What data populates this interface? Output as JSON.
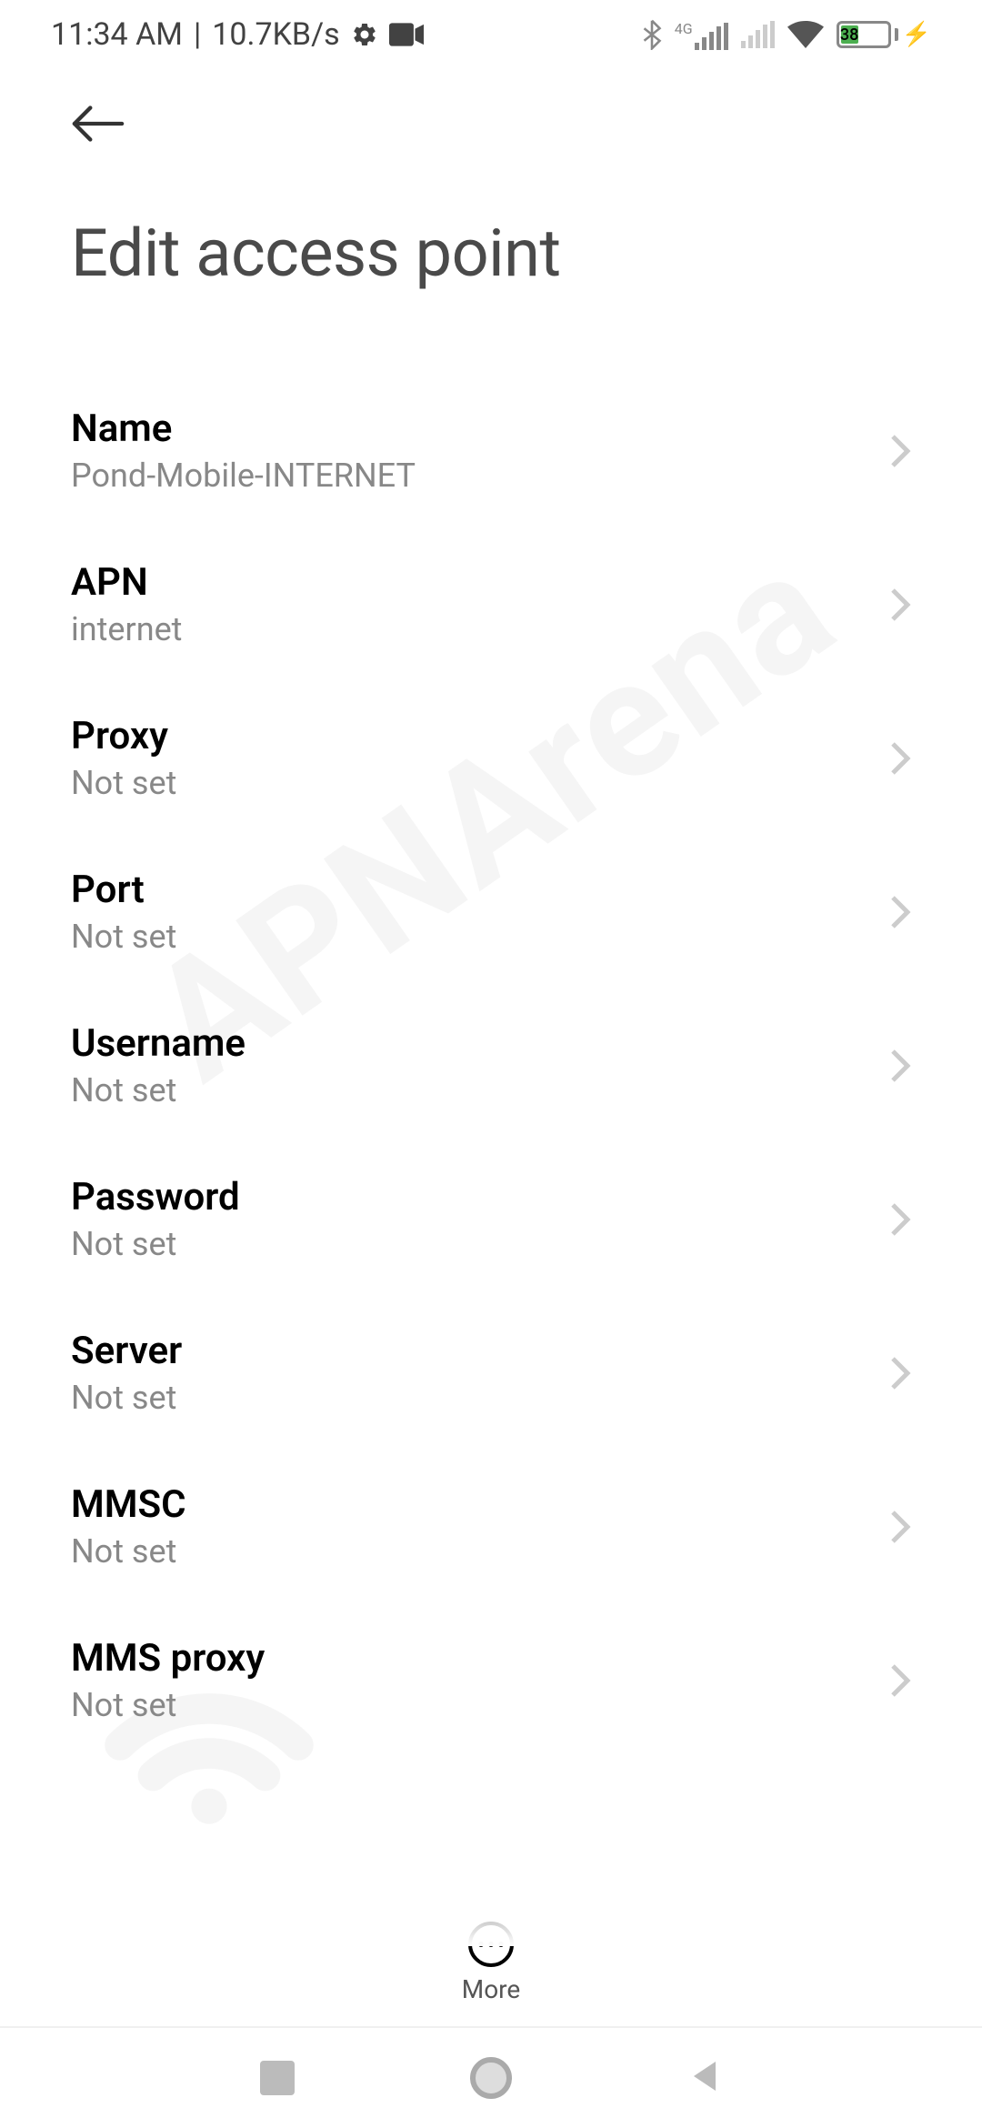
{
  "statusBar": {
    "time": "11:34 AM",
    "netSpeed": "10.7KB/s",
    "signalLabel": "4G",
    "batteryPercent": "38"
  },
  "header": {
    "title": "Edit access point"
  },
  "watermark": "APNArena",
  "settings": [
    {
      "label": "Name",
      "value": "Pond-Mobile-INTERNET"
    },
    {
      "label": "APN",
      "value": "internet"
    },
    {
      "label": "Proxy",
      "value": "Not set"
    },
    {
      "label": "Port",
      "value": "Not set"
    },
    {
      "label": "Username",
      "value": "Not set"
    },
    {
      "label": "Password",
      "value": "Not set"
    },
    {
      "label": "Server",
      "value": "Not set"
    },
    {
      "label": "MMSC",
      "value": "Not set"
    },
    {
      "label": "MMS proxy",
      "value": "Not set"
    }
  ],
  "bottomBar": {
    "moreLabel": "More"
  }
}
